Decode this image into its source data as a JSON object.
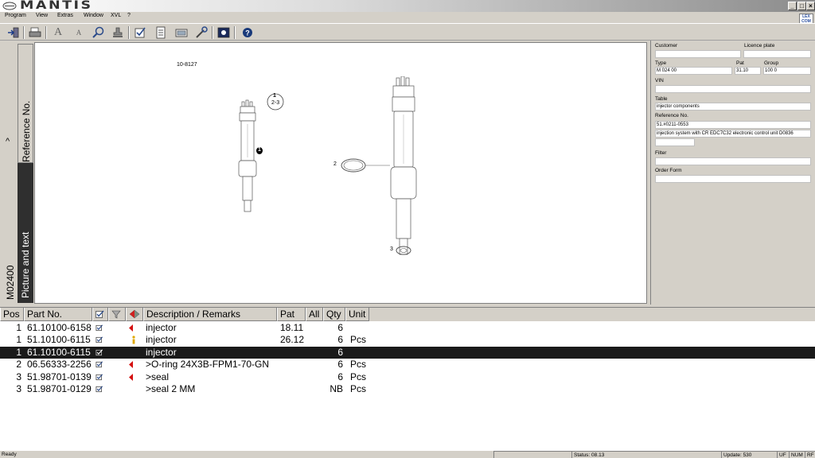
{
  "app": {
    "title": "MANTIS",
    "window_buttons": [
      "_",
      "□",
      "×"
    ]
  },
  "menu": {
    "items": [
      "Program",
      "View",
      "Extras",
      "Window",
      "XVL",
      "?"
    ],
    "right_icon_text": "LEX COM"
  },
  "toolbar": {
    "icons": [
      "exit-icon",
      "print-icon",
      "font-larger-icon",
      "font-smaller-icon",
      "zoom-icon",
      "stamp-icon",
      "checklist-icon",
      "document-icon",
      "folder-icon",
      "tools-icon",
      "picture-icon",
      "help-icon"
    ]
  },
  "side_tabs": {
    "reference": "Reference No.",
    "picture_text": "Picture and text",
    "model": "M02400",
    "caret": "^"
  },
  "picture": {
    "drawing_id": "10-8127",
    "callouts": [
      "1",
      "2-3",
      "1",
      "2",
      "3"
    ]
  },
  "right_panel": {
    "customer_label": "Customer",
    "customer_value": "",
    "licence_label": "Licence plate",
    "licence_value": "",
    "type_label": "Type",
    "type_value": "M 024 00",
    "pat_label": "Pat",
    "pat_value": "31.10",
    "group_label": "Group",
    "group_value": "100 0",
    "vin_label": "VIN",
    "vin_value": "",
    "table_label": "Table",
    "table_value": "injector components",
    "reference_label": "Reference No.",
    "reference_value": "51.#0211-0553",
    "reference_desc": "injection system with CR EDC7C32 electronic control unit D0836",
    "filter_label": "Filter",
    "filter_value": "",
    "order_label": "Order Form",
    "order_value": ""
  },
  "table": {
    "headers": {
      "pos": "Pos",
      "part_no": "Part No.",
      "description": "Description / Remarks",
      "pat": "Pat",
      "all": "All",
      "qty": "Qty",
      "unit": "Unit"
    },
    "header_icons": [
      "checkbox-icon",
      "funnel-icon",
      "flags-icon"
    ],
    "rows": [
      {
        "pos": "1",
        "part_no": "61.10100-6158",
        "flag": "red",
        "description": "injector",
        "pat": "18.11",
        "all": "",
        "qty": "6",
        "unit": "",
        "selected": false
      },
      {
        "pos": "1",
        "part_no": "51.10100-6115",
        "flag": "info",
        "description": "injector",
        "pat": "26.12",
        "all": "",
        "qty": "6",
        "unit": "Pcs",
        "selected": false
      },
      {
        "pos": "1",
        "part_no": "61.10100-6115",
        "flag": "",
        "description": "injector",
        "pat": "",
        "all": "",
        "qty": "6",
        "unit": "",
        "selected": true
      },
      {
        "pos": "2",
        "part_no": "06.56333-2256",
        "flag": "red",
        "description": ">O-ring 24X3B-FPM1-70-GN",
        "pat": "",
        "all": "",
        "qty": "6",
        "unit": "Pcs",
        "selected": false
      },
      {
        "pos": "3",
        "part_no": "51.98701-0139",
        "flag": "red",
        "description": ">seal",
        "pat": "",
        "all": "",
        "qty": "6",
        "unit": "Pcs",
        "selected": false
      },
      {
        "pos": "3",
        "part_no": "51.98701-0129",
        "flag": "",
        "description": ">seal 2 MM",
        "pat": "",
        "all": "",
        "qty": "NB",
        "unit": "Pcs",
        "selected": false
      }
    ]
  },
  "statusbar": {
    "ready": "Ready",
    "status": "Status: 08.13",
    "update": "Update: 530",
    "uf": "UF",
    "num": "NUM",
    "rf": "RF"
  }
}
